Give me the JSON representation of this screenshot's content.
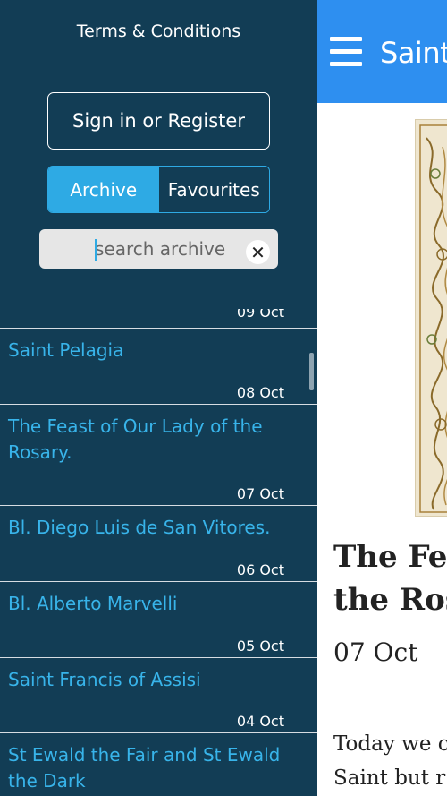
{
  "app": {
    "title_visible": "Saint",
    "menu_icon": "hamburger-icon",
    "bar_color": "#2e8ff0"
  },
  "drawer": {
    "terms_label": "Terms & Conditions",
    "signin_label": "Sign in or Register",
    "tabs": [
      {
        "label": "Archive",
        "active": true
      },
      {
        "label": "Favourites",
        "active": false
      }
    ],
    "search": {
      "placeholder": "search archive",
      "value": "",
      "clear_icon": "close-icon"
    },
    "partial_date": "09 Oct",
    "items": [
      {
        "title": "Saint Pelagia",
        "date": "08 Oct"
      },
      {
        "title": "The Feast of Our Lady of the Rosary.",
        "date": "07 Oct"
      },
      {
        "title": "Bl. Diego Luis de San Vitores.",
        "date": "06 Oct"
      },
      {
        "title": "Bl. Alberto Marvelli",
        "date": "05 Oct"
      },
      {
        "title": "Saint Francis of Assisi",
        "date": "04 Oct"
      },
      {
        "title": "St Ewald the Fair and St Ewald the Dark",
        "date": ""
      }
    ],
    "colors": {
      "background": "#123d55",
      "accent": "#2eaae4",
      "link": "#38b4ea"
    }
  },
  "article": {
    "title_line1": "The Fea",
    "title_line2": "the Ros",
    "date": "07 Oct",
    "body_line1": "Today we c",
    "body_line2": "Saint but r"
  }
}
